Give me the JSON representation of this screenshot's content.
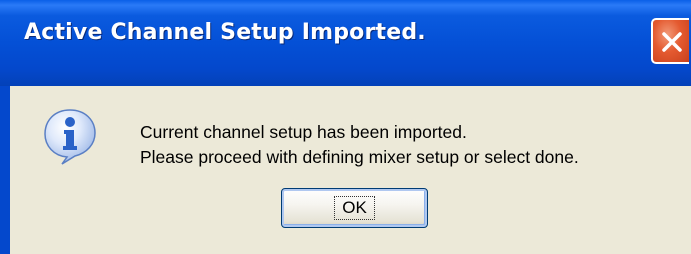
{
  "window": {
    "title": "Active Channel Setup Imported.",
    "close_icon": "close-icon"
  },
  "message": {
    "icon": "info-icon",
    "line1": "Current channel setup has been imported.",
    "line2": "Please proceed with defining mixer setup or select done."
  },
  "buttons": {
    "ok_label": "OK"
  },
  "colors": {
    "titlebar": "#0450d6",
    "close_button": "#e45a30",
    "dialog_background": "#ece9d8",
    "info_icon": "#2a62c8"
  }
}
